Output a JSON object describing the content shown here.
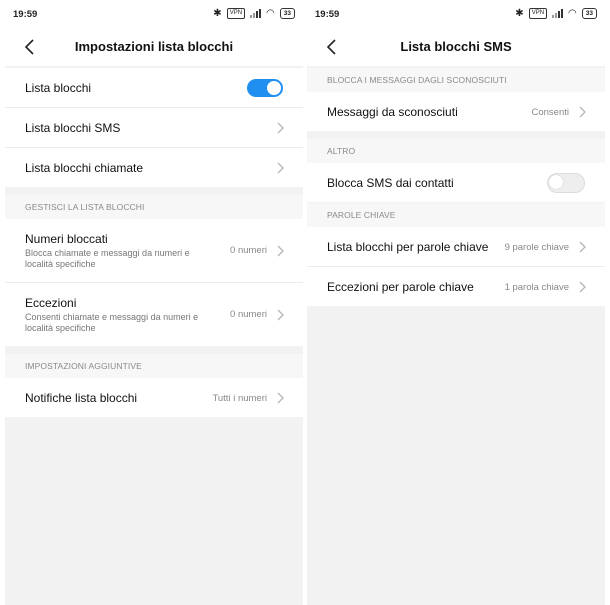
{
  "left": {
    "status": {
      "time": "19:59",
      "battery": "33"
    },
    "title": "Impostazioni lista blocchi",
    "rows_top": [
      {
        "label": "Lista blocchi",
        "toggle": true
      },
      {
        "label": "Lista blocchi SMS"
      },
      {
        "label": "Lista blocchi chiamate"
      }
    ],
    "section_manage": "GESTISCI LA LISTA BLOCCHI",
    "manage_rows": [
      {
        "label": "Numeri bloccati",
        "sub": "Blocca chiamate e messaggi da numeri e località specifiche",
        "value": "0 numeri"
      },
      {
        "label": "Eccezioni",
        "sub": "Consenti chiamate e messaggi da numeri e località specifiche",
        "value": "0 numeri"
      }
    ],
    "section_extra": "IMPOSTAZIONI AGGIUNTIVE",
    "extra_rows": [
      {
        "label": "Notifiche lista blocchi",
        "value": "Tutti i numeri"
      }
    ]
  },
  "right": {
    "status": {
      "time": "19:59",
      "battery": "33"
    },
    "title": "Lista blocchi SMS",
    "section_unknown": "BLOCCA I MESSAGGI DAGLI SCONOSCIUTI",
    "unknown_rows": [
      {
        "label": "Messaggi da sconosciuti",
        "value": "Consenti"
      }
    ],
    "section_other": "ALTRO",
    "other_rows": [
      {
        "label": "Blocca SMS dai contatti",
        "toggle": false
      }
    ],
    "section_keywords": "PAROLE CHIAVE",
    "keyword_rows": [
      {
        "label": "Lista blocchi per parole chiave",
        "value": "9 parole chiave"
      },
      {
        "label": "Eccezioni per parole chiave",
        "value": "1 parola chiave"
      }
    ]
  },
  "colors": {
    "accent": "#1f8ff0",
    "background": "#f2f2f2"
  }
}
